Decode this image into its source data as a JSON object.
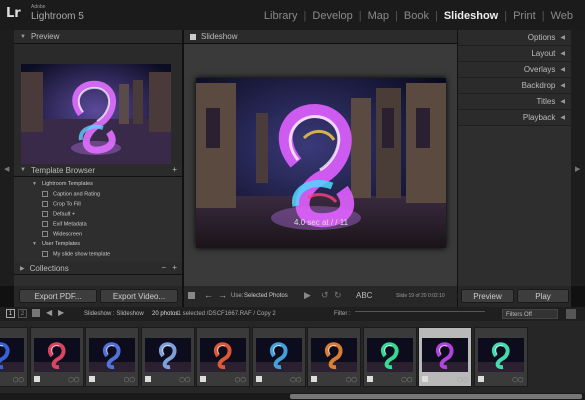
{
  "app": {
    "vendor": "Adobe",
    "name": "Lightroom 5",
    "logo": "Lr"
  },
  "modules": [
    {
      "label": "Library",
      "active": false
    },
    {
      "label": "Develop",
      "active": false
    },
    {
      "label": "Map",
      "active": false
    },
    {
      "label": "Book",
      "active": false
    },
    {
      "label": "Slideshow",
      "active": true
    },
    {
      "label": "Print",
      "active": false
    },
    {
      "label": "Web",
      "active": false
    }
  ],
  "left_panel": {
    "preview_title": "Preview",
    "template_browser_title": "Template Browser",
    "template_add": "+",
    "templates": [
      {
        "label": "Lightroom Templates",
        "folder": true
      },
      {
        "label": "Caption and Rating",
        "folder": false
      },
      {
        "label": "Crop To Fill",
        "folder": false
      },
      {
        "label": "Default +",
        "folder": false
      },
      {
        "label": "Exif Metadata",
        "folder": false
      },
      {
        "label": "Widescreen",
        "folder": false
      },
      {
        "label": "User Templates",
        "folder": true
      },
      {
        "label": "My slide show template",
        "folder": false
      }
    ],
    "collections_title": "Collections",
    "collections_minus": "−",
    "collections_plus": "+",
    "export_pdf": "Export PDF...",
    "export_video": "Export Video..."
  },
  "center": {
    "title": "Slideshow",
    "caption": "4.0 sec at / / 11",
    "toolbar": {
      "use_label": "Use:",
      "use_value": "Selected Photos",
      "abc": "ABC",
      "slide_counter": "Slide 19 of 20  0:02:10"
    }
  },
  "right_panel": {
    "sections": [
      "Options",
      "Layout",
      "Overlays",
      "Backdrop",
      "Titles",
      "Playback"
    ],
    "preview_button": "Preview",
    "play_button": "Play"
  },
  "filmstrip": {
    "page1": "1",
    "page2": "2",
    "source": "Slideshow : Slideshow",
    "count": "20 photos",
    "selection": "/1 selected /DSCF1667.RAF / Copy 2",
    "filter_label": "Filter :",
    "filter_value": "Filters Off",
    "thumbnails": [
      {
        "hue": "#3a6cf0",
        "selected": false
      },
      {
        "hue": "#f04a6a",
        "selected": false
      },
      {
        "hue": "#5a7af0",
        "selected": false
      },
      {
        "hue": "#8ab0f0",
        "selected": false
      },
      {
        "hue": "#f0603a",
        "selected": false
      },
      {
        "hue": "#4ab0f0",
        "selected": false
      },
      {
        "hue": "#f08a3a",
        "selected": false
      },
      {
        "hue": "#3af0a0",
        "selected": false
      },
      {
        "hue": "#c04af0",
        "selected": true
      },
      {
        "hue": "#4af0c0",
        "selected": false
      }
    ]
  },
  "colors": {
    "accent": "#eeeeee",
    "panel": "#2e2e2e",
    "background": "#111111"
  }
}
